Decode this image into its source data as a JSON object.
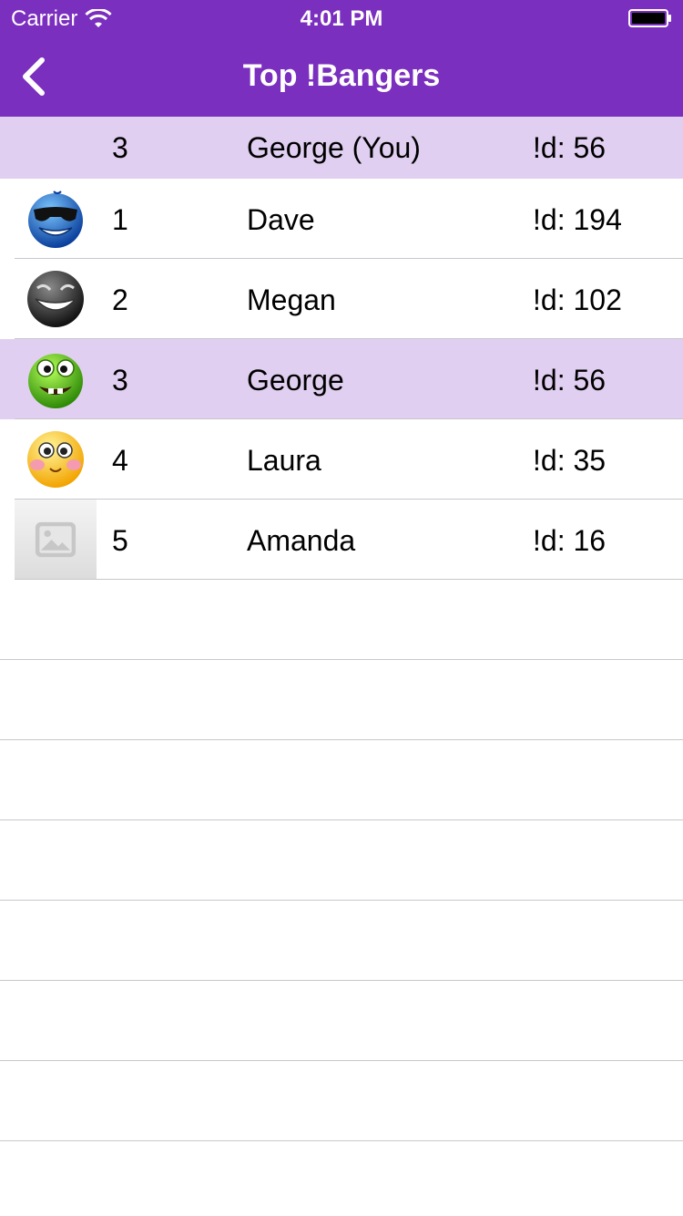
{
  "status_bar": {
    "carrier": "Carrier",
    "time": "4:01 PM"
  },
  "nav": {
    "title": "Top !Bangers",
    "back_icon": "chevron-left-icon"
  },
  "colors": {
    "primary": "#7b2fbe",
    "highlight": "#e0cff0",
    "separator": "#c8c7cc"
  },
  "my_rank": {
    "rank": "3",
    "name": "George (You)",
    "score": "!d: 56"
  },
  "leaderboard": [
    {
      "rank": "1",
      "name": "Dave",
      "score": "!d: 194",
      "avatar": "blue-sunglasses-smiley-icon"
    },
    {
      "rank": "2",
      "name": "Megan",
      "score": "!d: 102",
      "avatar": "black-grinning-smiley-icon"
    },
    {
      "rank": "3",
      "name": "George",
      "score": "!d: 56",
      "avatar": "green-goofy-smiley-icon",
      "highlighted": true
    },
    {
      "rank": "4",
      "name": "Laura",
      "score": "!d: 35",
      "avatar": "yellow-blushing-smiley-icon"
    },
    {
      "rank": "5",
      "name": "Amanda",
      "score": "!d: 16",
      "avatar": "image-placeholder-icon"
    }
  ]
}
